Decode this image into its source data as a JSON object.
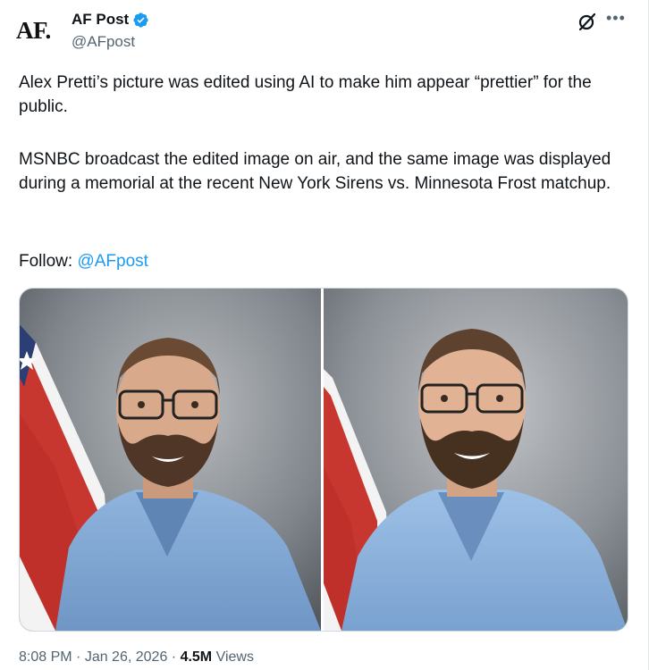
{
  "account": {
    "avatar_text": "AF.",
    "display_name": "AF Post",
    "handle": "@AFpost",
    "verified_color": "#1d9bf0"
  },
  "tweet": {
    "paragraph1": "Alex Pretti’s picture was edited using AI to make him appear “prettier” for the public.",
    "paragraph2": "MSNBC broadcast the edited image on air, and the same image was displayed during a memorial at the recent New York Sirens vs. Minnesota Frost matchup.",
    "follow_label": "Follow: ",
    "follow_mention": "@AFpost"
  },
  "media": {
    "images": [
      {
        "icon": "portrait-photo-original"
      },
      {
        "icon": "portrait-photo-edited"
      }
    ]
  },
  "meta": {
    "time": "8:08 PM",
    "separator": " · ",
    "date": "Jan 26, 2026",
    "views_count": "4.5M",
    "views_label": " Views"
  },
  "icons": {
    "verified": "verified-badge-icon",
    "grok": "grok-icon",
    "more": "more-icon"
  },
  "colors": {
    "text": "#0f1419",
    "secondary": "#536471",
    "link": "#1d9bf0"
  }
}
